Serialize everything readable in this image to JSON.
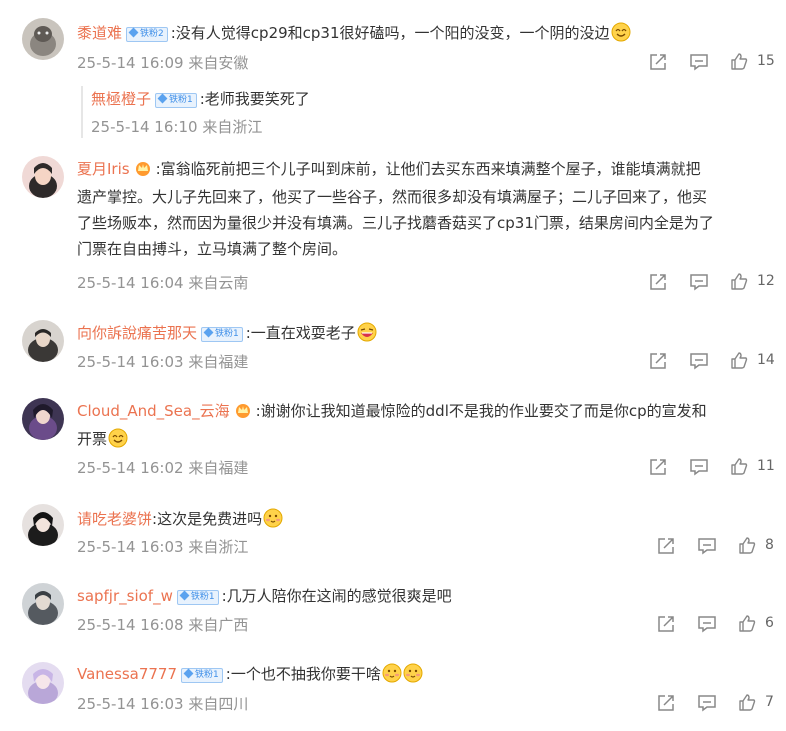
{
  "colors": {
    "username": "#eb7350",
    "badge": "#3f8fe8",
    "meta": "#939393",
    "text": "#333333"
  },
  "comments": [
    {
      "username": "黍道难",
      "badge": "铁粉2",
      "text": ":没有人觉得cp29和cp31很好磕吗，一个阳的没变，一个阴的没边",
      "emoji": "smile-emoji",
      "time": "25-5-14 16:09",
      "location": "来自安徽",
      "likes": "15",
      "reply": {
        "username": "無極橙子",
        "badge": "铁粉1",
        "text": ":老师我要笑死了",
        "time": "25-5-14 16:10",
        "location": "来自浙江"
      }
    },
    {
      "username": "夏月Iris",
      "crown": true,
      "lines": [
        ":富翁临死前把三个儿子叫到床前，让他们去买东西来填满整个屋子，谁能填满就把",
        "遗产掌控。大儿子先回来了，他买了一些谷子，然而很多却没有填满屋子；二儿子回来了，他买",
        "了些场贩本，然而因为量很少并没有填满。三儿子找蘑香菇买了cp31门票，结果房间内全是为了",
        "门票在自由搏斗，立马填满了整个房间。"
      ],
      "time": "25-5-14 16:04",
      "location": "来自云南",
      "likes": "12"
    },
    {
      "username": "向你訴說痛苦那天",
      "badge": "铁粉1",
      "text": ":一直在戏耍老子",
      "emoji": "laughing-emoji",
      "time": "25-5-14 16:03",
      "location": "来自福建",
      "likes": "14"
    },
    {
      "username": "Cloud_And_Sea_云海",
      "crown": true,
      "lines": [
        ":谢谢你让我知道最惊险的ddl不是我的作业要交了而是你cp的宣发和",
        "开票"
      ],
      "emoji": "smile-emoji",
      "time": "25-5-14 16:02",
      "location": "来自福建",
      "likes": "11"
    },
    {
      "username": "请吃老婆饼",
      "text": ":这次是免费进吗",
      "emoji": "blush-emoji",
      "time": "25-5-14 16:03",
      "location": "来自浙江",
      "likes": "8"
    },
    {
      "username": "sapfjr_siof_w",
      "badge": "铁粉1",
      "text": ":几万人陪你在这闹的感觉很爽是吧",
      "time": "25-5-14 16:08",
      "location": "来自广西",
      "likes": "6"
    },
    {
      "username": "Vanessa7777",
      "badge": "铁粉1",
      "text": ":一个也不抽我你要干啥",
      "emoji": "blush-emoji",
      "time": "25-5-14 16:03",
      "location": "来自四川",
      "likes": "7"
    }
  ]
}
